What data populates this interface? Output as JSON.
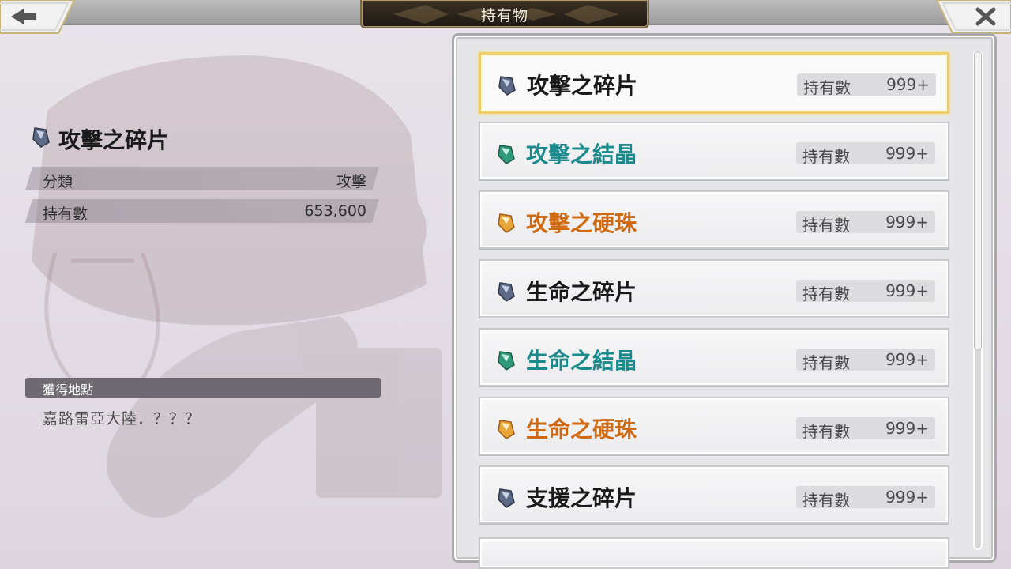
{
  "header": {
    "title": "持有物"
  },
  "detail": {
    "name": "攻擊之碎片",
    "rows": [
      {
        "label": "分類",
        "value": "攻擊"
      },
      {
        "label": "持有數",
        "value": "653,600"
      }
    ],
    "source_header": "獲得地點",
    "source_text": "嘉路雷亞大陸．？？？"
  },
  "items": [
    {
      "name": "攻擊之碎片",
      "qty_label": "持有數",
      "qty": "999+",
      "icon": "shard-gray-icon",
      "color": "#1a1a1a"
    },
    {
      "name": "攻擊之結晶",
      "qty_label": "持有數",
      "qty": "999+",
      "icon": "crystal-green-icon",
      "color": "#1b8a8c"
    },
    {
      "name": "攻擊之硬珠",
      "qty_label": "持有數",
      "qty": "999+",
      "icon": "gem-gold-icon",
      "color": "#d06a12"
    },
    {
      "name": "生命之碎片",
      "qty_label": "持有數",
      "qty": "999+",
      "icon": "shard-gray-icon",
      "color": "#1a1a1a"
    },
    {
      "name": "生命之結晶",
      "qty_label": "持有數",
      "qty": "999+",
      "icon": "crystal-green-icon",
      "color": "#1b8a8c"
    },
    {
      "name": "生命之硬珠",
      "qty_label": "持有數",
      "qty": "999+",
      "icon": "gem-gold-icon",
      "color": "#d06a12"
    },
    {
      "name": "支援之碎片",
      "qty_label": "持有數",
      "qty": "999+",
      "icon": "shard-gray-icon",
      "color": "#1a1a1a"
    }
  ],
  "colors": {
    "selected_border": "#f0cf6a",
    "teal": "#1b8a8c",
    "orange": "#d06a12"
  }
}
